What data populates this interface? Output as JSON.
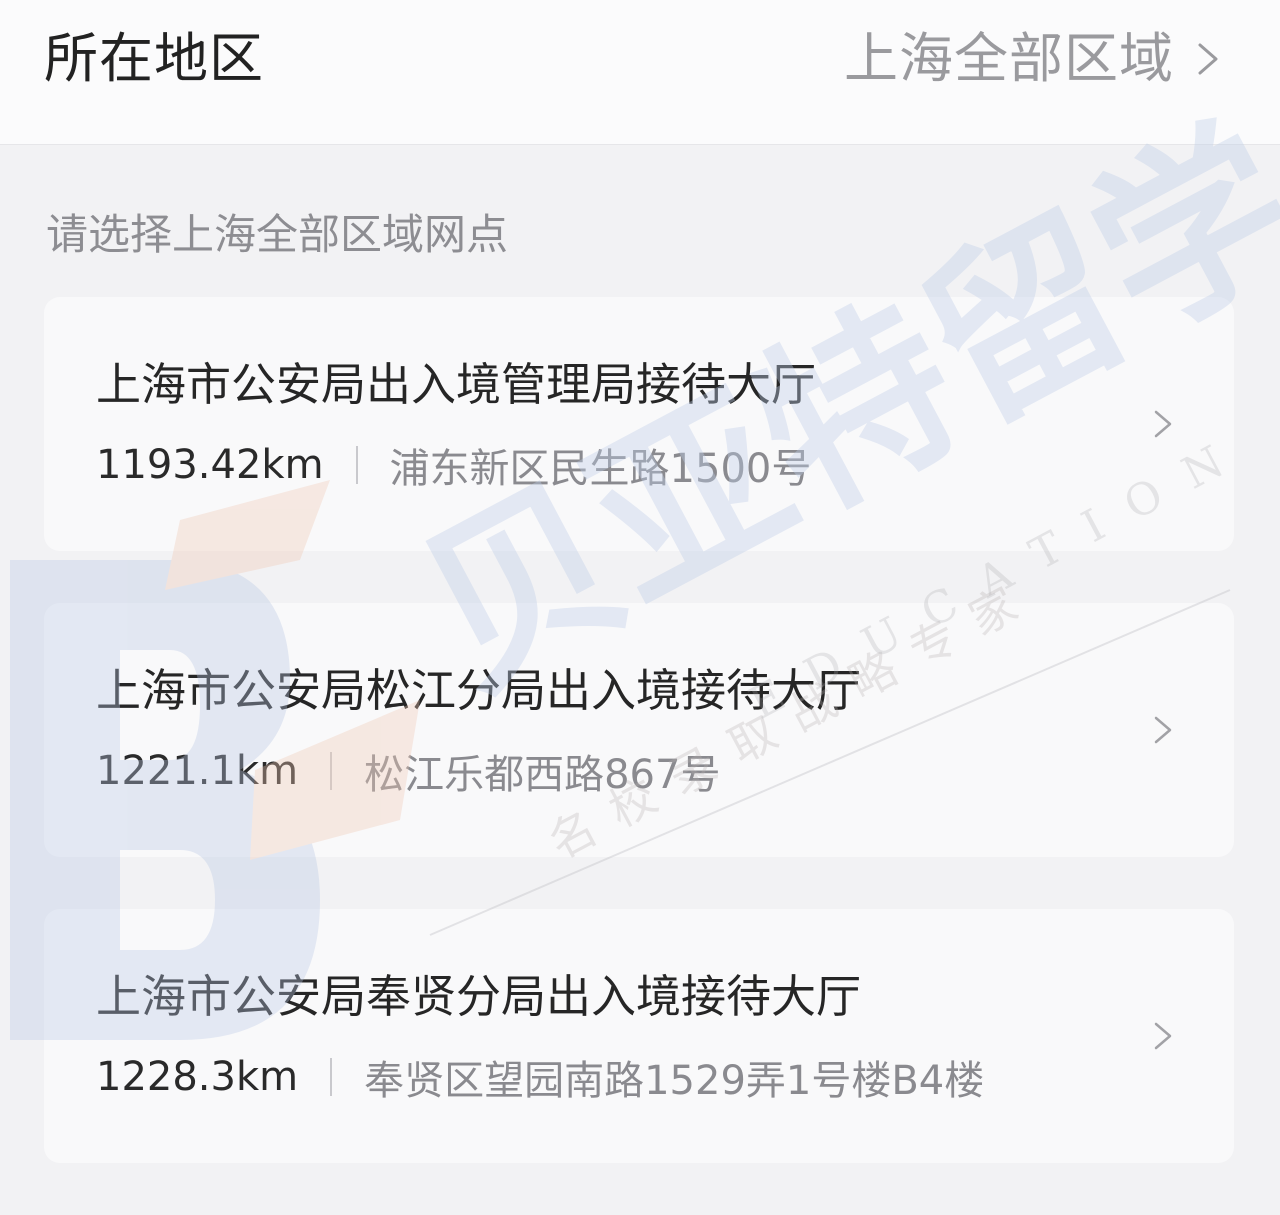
{
  "header": {
    "label": "所在地区",
    "region_value": "上海全部区域",
    "chevron_icon": "chevron-right-icon"
  },
  "section_hint": "请选择上海全部区域网点",
  "branches": [
    {
      "name": "上海市公安局出入境管理局接待大厅",
      "distance": "1193.42km",
      "address": "浦东新区民生路1500号"
    },
    {
      "name": "上海市公安局松江分局出入境接待大厅",
      "distance": "1221.1km",
      "address": "松江乐都西路867号"
    },
    {
      "name": "上海市公安局奉贤分局出入境接待大厅",
      "distance": "1228.3km",
      "address": "奉贤区望园南路1529弄1号楼B4楼"
    }
  ],
  "watermark": {
    "brand": "贝亚特留学",
    "slogan": "名校录取战略专家",
    "latin": "EDUCATION"
  },
  "colors": {
    "page_bg": "#f2f2f4",
    "card_bg": "#f9f9fa",
    "title_text": "#222222",
    "secondary_text": "#8d8d92",
    "watermark_blue": "#c9d6ec",
    "watermark_orange": "#f0c9b4"
  }
}
